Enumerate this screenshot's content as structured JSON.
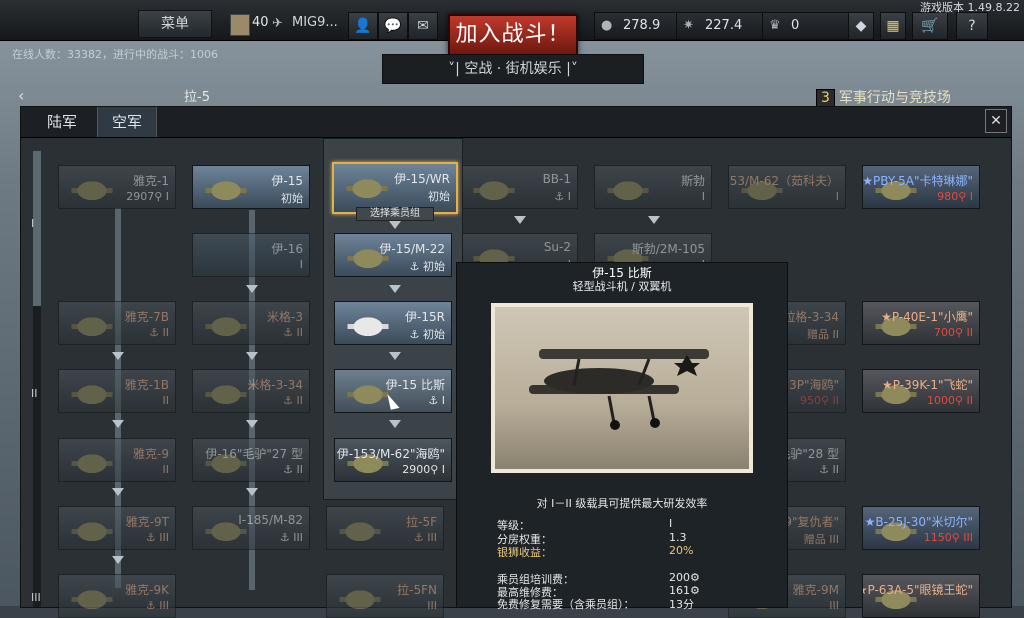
{
  "topbar": {
    "menu": "菜单",
    "level": "40",
    "nickname": "MIG9...",
    "battle_button": "加入战斗！",
    "game_mode": "˅| 空战 · 街机娱乐 |˅",
    "silver_lions": "278.9",
    "research": "227.4",
    "golden_eagles": "0",
    "version": "游戏版本 1.49.8.22",
    "help": "?"
  },
  "online_status": "在线人数：33382，进行中的战斗：1006",
  "breadcrumb": "拉-5",
  "event_badge": {
    "count": "3",
    "label": "军事行动与竞技场"
  },
  "tabs": [
    "陆军",
    "空军"
  ],
  "rank_labels": [
    "I",
    "II",
    "III"
  ],
  "cards": [
    {
      "name": "雅克-1",
      "stat": "2907⚲ I"
    },
    {
      "name": "伊-15",
      "stat": "初始"
    },
    {
      "name": "伊-16",
      "stat": "I"
    },
    {
      "name": "雅克-7B",
      "stat": "⚓ II"
    },
    {
      "name": "米格-3",
      "stat": "⚓ II"
    },
    {
      "name": "雅克-1B",
      "stat": "II"
    },
    {
      "name": "米格-3-34",
      "stat": "⚓ II"
    },
    {
      "name": "雅克-9",
      "stat": "II"
    },
    {
      "name": "伊-16\"毛驴\"27 型",
      "stat": "⚓ II"
    },
    {
      "name": "雅克-9T",
      "stat": "⚓ III"
    },
    {
      "name": "I-185/M-82",
      "stat": "⚓ III"
    },
    {
      "name": "雅克-9K",
      "stat": "⚓ III"
    },
    {
      "name": "伊-15/WR",
      "stat": "初始"
    },
    {
      "name": "伊-15/M-22",
      "stat": "⚓ 初始"
    },
    {
      "name": "伊-15R",
      "stat": "⚓ 初始"
    },
    {
      "name": "伊-15 比斯",
      "stat": "⚓ I"
    },
    {
      "name": "伊-153/M-62\"海鸥\"",
      "stat": "2900⚲ I"
    },
    {
      "name": "BB-1",
      "stat": "⚓ I"
    },
    {
      "name": "Su-2",
      "stat": "I"
    },
    {
      "name": "拉-5F",
      "stat": "⚓ III"
    },
    {
      "name": "拉-5FN",
      "stat": "III"
    },
    {
      "name": "斯勃",
      "stat": "I"
    },
    {
      "name": "斯勃/2M-105",
      "stat": "I"
    },
    {
      "name": "伊-153/M-62（茹科夫）",
      "stat": "I"
    },
    {
      "name": "拉格-3-34",
      "stat": "赠品 II"
    },
    {
      "name": "伊-153P\"海鸥\"",
      "stat": "950⚲ II"
    },
    {
      "name": "伊-16\"毛驴\"28 型",
      "stat": "⚓ II"
    },
    {
      "name": "P-39\"复仇者\"",
      "stat": "赠品 III"
    },
    {
      "name": "雅克-9M",
      "stat": "III"
    },
    {
      "name": "★PBY-5A\"卡特琳娜\"",
      "stat": "980⚲ I"
    },
    {
      "name": "★P-40E-1\"小鹰\"",
      "stat": "700⚲ II"
    },
    {
      "name": "★P-39K-1\"飞蛇\"",
      "stat": "1000⚲ II"
    },
    {
      "name": "★B-25J-30\"米切尔\"",
      "stat": "1150⚲ III"
    },
    {
      "name": "★P-63A-5\"眼镜王蛇\"",
      "stat": ""
    }
  ],
  "crew_label": "选择乘员组",
  "tooltip": {
    "title": "伊-15 比斯",
    "subtitle": "轻型战斗机 / 双翼机",
    "description": "对 I－II 级载具可提供最大研发效率",
    "rows": [
      {
        "label": "等级：",
        "value": "I"
      },
      {
        "label": "分房权重：",
        "value": "1.3"
      },
      {
        "label": "银狮收益：",
        "value": "20%"
      },
      {
        "label": "乘员组培训费：",
        "value": "200⚙"
      },
      {
        "label": "最高维修费：",
        "value": "161⚙"
      },
      {
        "label": "免费修复需要（含乘员组）：",
        "value": "13分"
      }
    ]
  }
}
